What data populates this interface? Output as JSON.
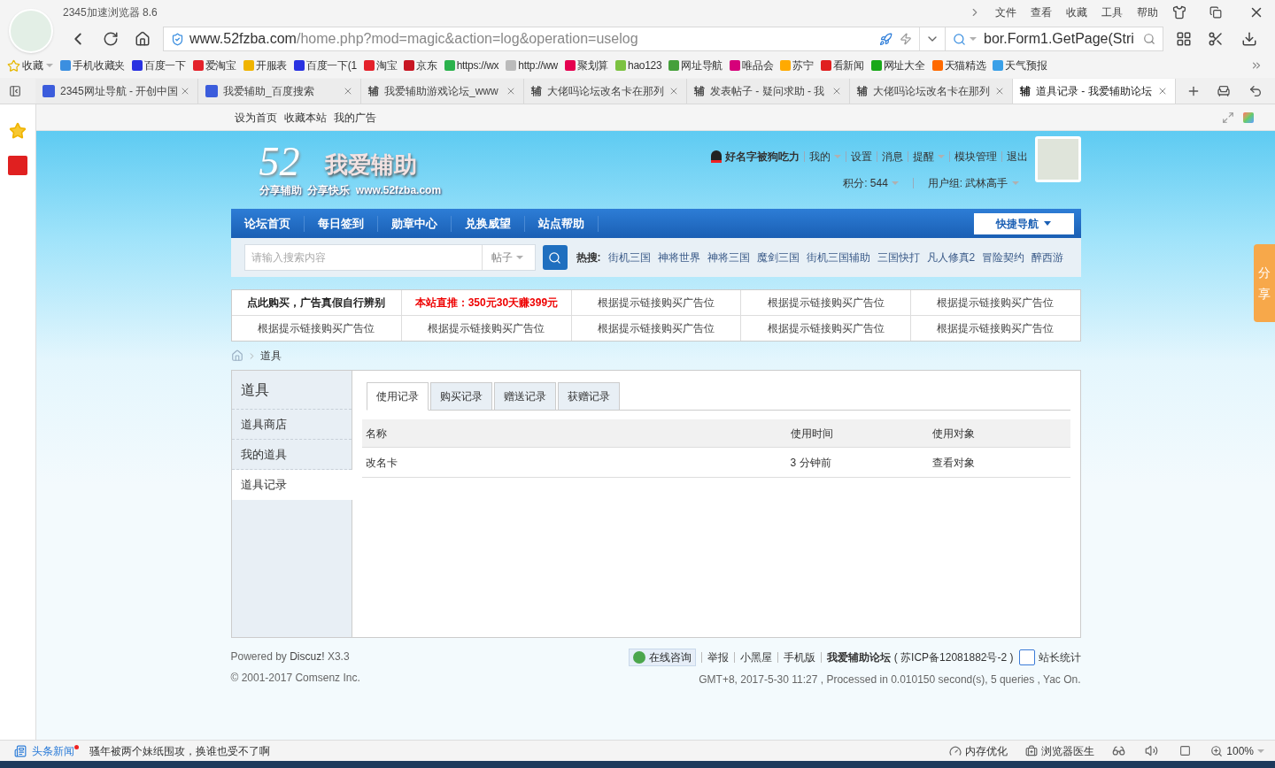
{
  "browser": {
    "title": "2345加速浏览器 8.6",
    "menu": [
      "文件",
      "查看",
      "收藏",
      "工具",
      "帮助"
    ],
    "address": {
      "host": "www.52fzba.com",
      "path": "/home.php?mod=magic&action=log&operation=uselog"
    },
    "search": {
      "value": "bor.Form1.GetPage(Stri"
    },
    "favorites_label": "收藏",
    "bookmarks": [
      {
        "label": "手机收藏夹",
        "color": "#3b8fe0"
      },
      {
        "label": "百度一下",
        "color": "#2932e1"
      },
      {
        "label": "爱淘宝",
        "color": "#e4222b"
      },
      {
        "label": "开服表",
        "color": "#f0b400"
      },
      {
        "label": "百度一下(1",
        "color": "#2932e1"
      },
      {
        "label": "淘宝",
        "color": "#e4222b"
      },
      {
        "label": "京东",
        "color": "#c81623"
      },
      {
        "label": "https://wx",
        "color": "#2bb24c"
      },
      {
        "label": "http://ww",
        "color": "#bbbbbb"
      },
      {
        "label": "聚划算",
        "color": "#e5004f"
      },
      {
        "label": "hao123",
        "color": "#7cc241"
      },
      {
        "label": "网址导航",
        "color": "#45a03b"
      },
      {
        "label": "唯品会",
        "color": "#d6007a"
      },
      {
        "label": "苏宁",
        "color": "#ffaa00"
      },
      {
        "label": "看新闻",
        "color": "#e02020"
      },
      {
        "label": "网址大全",
        "color": "#19a819"
      },
      {
        "label": "天猫精选",
        "color": "#ff6a00"
      },
      {
        "label": "天气预报",
        "color": "#3aa0e8"
      }
    ],
    "tabs": [
      {
        "label": "2345网址导航 - 开创中国",
        "selected": false
      },
      {
        "label": "我爱辅助_百度搜索",
        "selected": false
      },
      {
        "label": "我爱辅助游戏论坛_www",
        "favicon": "辅",
        "selected": false
      },
      {
        "label": "大佬吗论坛改名卡在那列",
        "favicon": "辅",
        "selected": false
      },
      {
        "label": "发表帖子 - 疑问求助 - 我",
        "favicon": "辅",
        "selected": false
      },
      {
        "label": "大佬吗论坛改名卡在那列",
        "favicon": "辅",
        "selected": false
      },
      {
        "label": "道具记录 - 我爱辅助论坛",
        "favicon": "辅",
        "selected": true
      }
    ]
  },
  "site": {
    "toplinks": [
      "设为首页",
      "收藏本站",
      "我的广告"
    ],
    "logo": {
      "number": "52",
      "name": "我爱辅助",
      "tagline": "分享辅助  分享快乐  www.52fzba.com"
    },
    "user": {
      "name": "好名字被狗吃力",
      "links": [
        {
          "label": "我的",
          "dropdown": true
        },
        {
          "label": "设置",
          "dropdown": false
        },
        {
          "label": "消息",
          "dropdown": false
        },
        {
          "label": "提醒",
          "dropdown": true
        },
        {
          "label": "模块管理",
          "dropdown": false
        },
        {
          "label": "退出",
          "dropdown": false
        }
      ],
      "points": "积分: 544",
      "group": "用户组: 武林高手"
    },
    "nav": [
      "论坛首页",
      "每日签到",
      "勋章中心",
      "兑换威望",
      "站点帮助"
    ],
    "quick_nav": "快捷导航",
    "search": {
      "placeholder": "请输入搜索内容",
      "scope": "帖子"
    },
    "hot": {
      "label": "热搜:",
      "items": [
        "街机三国",
        "神将世界",
        "神将三国",
        "魔剑三国",
        "街机三国辅助",
        "三国快打",
        "凡人修真2",
        "冒险契约",
        "醉西游"
      ]
    },
    "ads": [
      [
        {
          "text": "点此购买，广告真假自行辨别",
          "kind": "notice"
        },
        {
          "text": "本站直推：350元30天赚399元",
          "kind": "promo"
        },
        {
          "text": "根据提示链接购买广告位",
          "kind": "slot"
        },
        {
          "text": "根据提示链接购买广告位",
          "kind": "slot"
        },
        {
          "text": "根据提示链接购买广告位",
          "kind": "slot"
        }
      ],
      [
        {
          "text": "根据提示链接购买广告位",
          "kind": "slot"
        },
        {
          "text": "根据提示链接购买广告位",
          "kind": "slot"
        },
        {
          "text": "根据提示链接购买广告位",
          "kind": "slot"
        },
        {
          "text": "根据提示链接购买广告位",
          "kind": "slot"
        },
        {
          "text": "根据提示链接购买广告位",
          "kind": "slot"
        }
      ]
    ],
    "breadcrumb": "道具",
    "sidebar": {
      "title": "道具",
      "items": [
        {
          "label": "道具商店",
          "selected": false
        },
        {
          "label": "我的道具",
          "selected": false
        },
        {
          "label": "道具记录",
          "selected": true
        }
      ]
    },
    "subtabs": [
      {
        "label": "使用记录",
        "selected": true
      },
      {
        "label": "购买记录",
        "selected": false
      },
      {
        "label": "赠送记录",
        "selected": false
      },
      {
        "label": "获赠记录",
        "selected": false
      }
    ],
    "table": {
      "columns": [
        "名称",
        "使用时间",
        "使用对象"
      ],
      "rows": [
        [
          "改名卡",
          "3 分钟前",
          "查看对象"
        ]
      ]
    },
    "footer": {
      "powered": "Powered by ",
      "discuz": "Discuz!",
      "version": " X3.3",
      "copyright": "© 2001-2017 Comsenz Inc.",
      "consult": "在线咨询",
      "links": [
        "举报",
        "小黑屋",
        "手机版"
      ],
      "forum": "我爱辅助论坛",
      "icp": "( 苏ICP备12081882号-2 )",
      "stats": "站长统计",
      "processed": "GMT+8, 2017-5-30 11:27 , Processed in 0.010150 second(s), 5 queries , Yac On."
    },
    "share": "分享"
  },
  "status_bar": {
    "news_label": "头条新闻",
    "headline": "骚年被两个妹纸围攻，换谁也受不了啊",
    "memory": "内存优化",
    "doctor": "浏览器医生",
    "zoom": "100%"
  }
}
